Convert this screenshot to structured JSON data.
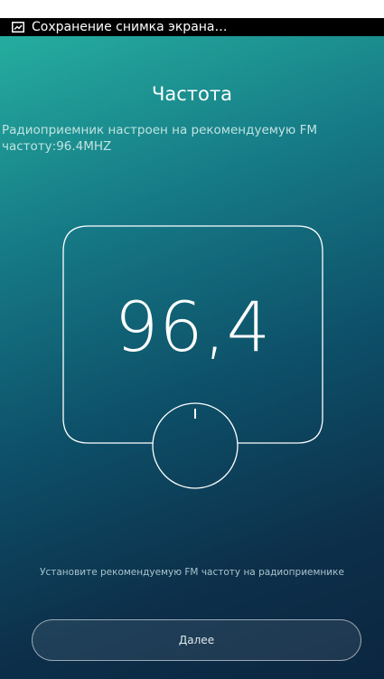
{
  "status_bar": {
    "notification_text": "Сохранение снимка экрана…",
    "notification_icon": "screenshot-icon"
  },
  "screen": {
    "title": "Частота",
    "subtitle": "Радиоприемник настроен на рекомендуемую FM частоту:96.4MHZ",
    "frequency_display": "96,4",
    "tuning_knob_icon": "tuning-knob-icon",
    "hint": "Установите рекомендуемую FM частоту на радиоприемнике",
    "next_button_label": "Далее"
  },
  "colors": {
    "gradient_top": "#25ad9f",
    "gradient_bottom": "#0b2640",
    "text_primary": "#ffffff",
    "statusbar_bg": "#000000"
  }
}
